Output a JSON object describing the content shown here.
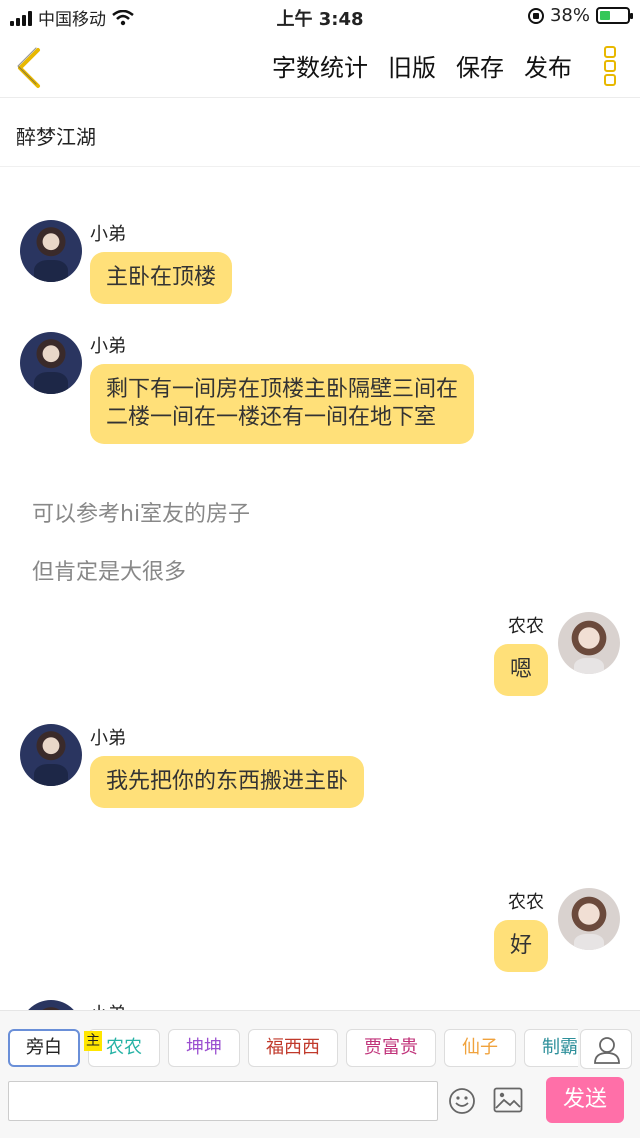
{
  "status_bar": {
    "carrier": "中国移动",
    "time": "上午 3:48",
    "battery": "38%",
    "battery_level": 0.38
  },
  "nav": {
    "actions": [
      "字数统计",
      "旧版",
      "保存",
      "发布"
    ]
  },
  "story": {
    "title": "醉梦江湖"
  },
  "messages": [
    {
      "type": "left",
      "speaker": "小弟",
      "text": "主卧在顶楼"
    },
    {
      "type": "left",
      "speaker": "小弟",
      "text": "剩下有一间房在顶楼主卧隔壁三间在二楼一间在一楼还有一间在地下室"
    },
    {
      "type": "narration",
      "text": "可以参考hi室友的房子"
    },
    {
      "type": "narration",
      "text": "但肯定是大很多"
    },
    {
      "type": "right",
      "speaker": "农农",
      "text": "嗯"
    },
    {
      "type": "left",
      "speaker": "小弟",
      "text": "我先把你的东西搬进主卧"
    },
    {
      "type": "right",
      "speaker": "农农",
      "text": "好"
    },
    {
      "type": "left",
      "speaker": "小弟",
      "text": ""
    }
  ],
  "roles": [
    {
      "label": "旁白",
      "color": "#222222"
    },
    {
      "label": "农农",
      "color": "#27b3a6"
    },
    {
      "label": "坤坤",
      "color": "#9b4fd0"
    },
    {
      "label": "福西西",
      "color": "#c0392b"
    },
    {
      "label": "贾富贵",
      "color": "#c0337a"
    },
    {
      "label": "仙子",
      "color": "#f0a23c"
    },
    {
      "label": "制霸",
      "color": "#2d8f9a"
    }
  ],
  "role_badge": "主",
  "composer": {
    "input_value": "",
    "send_label": "发送"
  },
  "colors": {
    "bubble": "#ffe079",
    "accent": "#e8b800",
    "send": "#ff6fa8"
  }
}
